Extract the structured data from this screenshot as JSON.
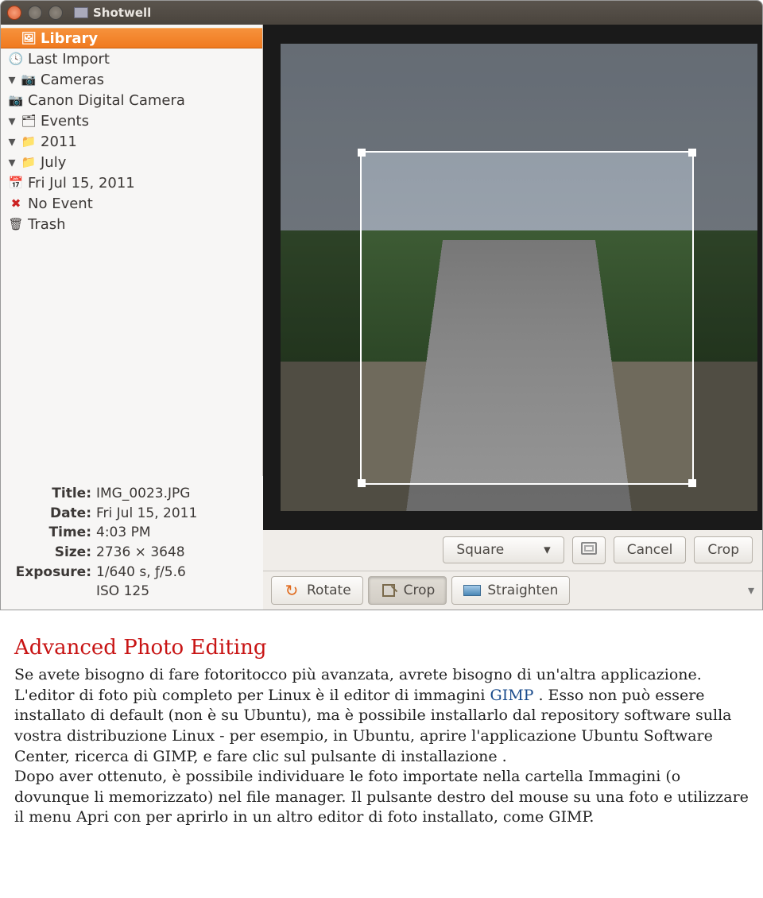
{
  "window": {
    "title": "Shotwell"
  },
  "sidebar": {
    "library": "Library",
    "last_import": "Last Import",
    "cameras": "Cameras",
    "camera_name": "Canon Digital Camera",
    "events": "Events",
    "year": "2011",
    "month": "July",
    "date": "Fri Jul 15, 2011",
    "no_event": "No Event",
    "trash": "Trash"
  },
  "crop": {
    "aspect_label": "Square",
    "cancel": "Cancel",
    "crop": "Crop"
  },
  "tools": {
    "rotate": "Rotate",
    "crop": "Crop",
    "straighten": "Straighten"
  },
  "meta": {
    "title_label": "Title:",
    "title_value": "IMG_0023.JPG",
    "date_label": "Date:",
    "date_value": "Fri Jul 15, 2011",
    "time_label": "Time:",
    "time_value": "4:03 PM",
    "size_label": "Size:",
    "size_value": "2736 × 3648",
    "exposure_label": "Exposure:",
    "exposure_value1": "1/640 s, ƒ/5.6",
    "exposure_value2": "ISO 125"
  },
  "doc": {
    "heading": "Advanced Photo Editing",
    "p1a": "Se avete bisogno di fare fotoritocco più avanzata, avrete bisogno di un'altra applicazione. L'editor di foto più completo per Linux è il editor di immagini ",
    "p1_link": "GIMP",
    "p1b": " . Esso non può essere installato di default (non è su Ubuntu), ma è possibile installarlo dal repository software sulla vostra distribuzione Linux - per esempio, in Ubuntu, aprire l'applicazione Ubuntu Software Center, ricerca di GIMP, e fare clic sul pulsante di installazione .",
    "p2": "Dopo aver ottenuto, è possibile individuare le foto importate nella cartella Immagini (o dovunque li memorizzato) nel file manager. Il pulsante destro del mouse su una foto e utilizzare il menu Apri con per aprirlo in un altro editor di foto installato, come GIMP."
  }
}
